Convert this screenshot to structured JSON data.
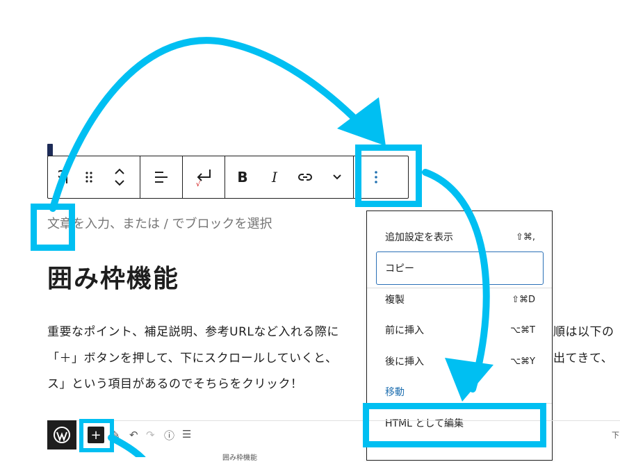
{
  "toolbar": {
    "paragraph_icon": "paragraph-icon",
    "drag_icon": "drag-handle-icon",
    "move_icon": "move-up-down-icon",
    "align_icon": "align-left-icon",
    "enter_icon": "return-icon",
    "bold_label": "B",
    "italic_label": "I",
    "link_icon": "link-icon",
    "more_icon": "chevron-down-icon",
    "options_icon": "more-vertical-icon"
  },
  "placeholder": "文章を入力、または / でブロックを選択",
  "heading": "囲み枠機能",
  "paragraph_lines": [
    "重要なポイント、補足説明、参考URLなど入れる際に",
    "「＋」ボタンを押して、下にスクロールしていくと、",
    "ス」という項目があるのでそちらをクリック！"
  ],
  "paragraph_right": [
    "順は以下の",
    "出てきて、"
  ],
  "menu": {
    "items": [
      {
        "label": "追加設定を表示",
        "shortcut": "⇧⌘,"
      },
      {
        "label": "コピー",
        "shortcut": ""
      },
      {
        "label": "複製",
        "shortcut": "⇧⌘D"
      },
      {
        "label": "前に挿入",
        "shortcut": "⌥⌘T"
      },
      {
        "label": "後に挿入",
        "shortcut": "⌥⌘Y"
      },
      {
        "label": "移動",
        "shortcut": ""
      },
      {
        "label": "HTML として編集",
        "shortcut": ""
      }
    ]
  },
  "editor_strip": {
    "plus_label": "+",
    "right_text": "下",
    "doc_text": "囲み枠機能"
  },
  "colors": {
    "highlight": "#00bff2",
    "accent": "#2271b1"
  }
}
